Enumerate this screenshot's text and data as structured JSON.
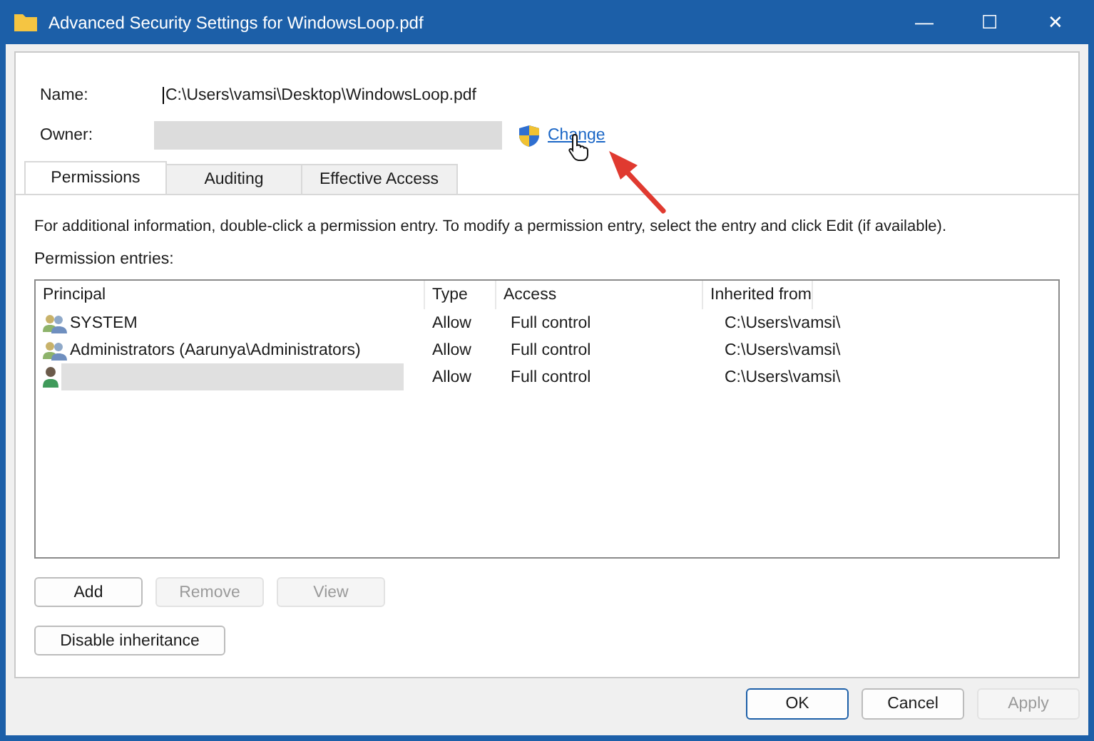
{
  "window": {
    "title": "Advanced Security Settings for WindowsLoop.pdf",
    "controls": [
      "—",
      "☐",
      "✕"
    ]
  },
  "name": {
    "label": "Name:",
    "value": "C:\\Users\\vamsi\\Desktop\\WindowsLoop.pdf"
  },
  "owner": {
    "label": "Owner:",
    "redacted": true,
    "change_link": "Change"
  },
  "tabs": [
    {
      "label": "Permissions",
      "selected": true
    },
    {
      "label": "Auditing",
      "selected": false
    },
    {
      "label": "Effective Access",
      "selected": false
    }
  ],
  "info": "For additional information, double-click a permission entry. To modify a permission entry, select the entry and click Edit (if available).",
  "entries_label": "Permission entries:",
  "table": {
    "columns": [
      "Principal",
      "Type",
      "Access",
      "Inherited from"
    ],
    "rows": [
      {
        "principal": "SYSTEM",
        "kind": "group",
        "redacted": false,
        "type": "Allow",
        "access": "Full control",
        "inherited_from": "C:\\Users\\vamsi\\"
      },
      {
        "principal": "Administrators (Aarunya\\Administrators)",
        "kind": "group",
        "redacted": false,
        "type": "Allow",
        "access": "Full control",
        "inherited_from": "C:\\Users\\vamsi\\"
      },
      {
        "kind": "user",
        "redacted": true,
        "type": "Allow",
        "access": "Full control",
        "inherited_from": "C:\\Users\\vamsi\\"
      }
    ]
  },
  "entry_buttons": [
    {
      "label": "Add",
      "disabled": false
    },
    {
      "label": "Remove",
      "disabled": true
    },
    {
      "label": "View",
      "disabled": true
    }
  ],
  "inheritance_button": "Disable inheritance",
  "dialog_buttons": [
    {
      "label": "OK",
      "disabled": false,
      "default": true
    },
    {
      "label": "Cancel",
      "disabled": false,
      "default": false
    },
    {
      "label": "Apply",
      "disabled": true,
      "default": false
    }
  ]
}
